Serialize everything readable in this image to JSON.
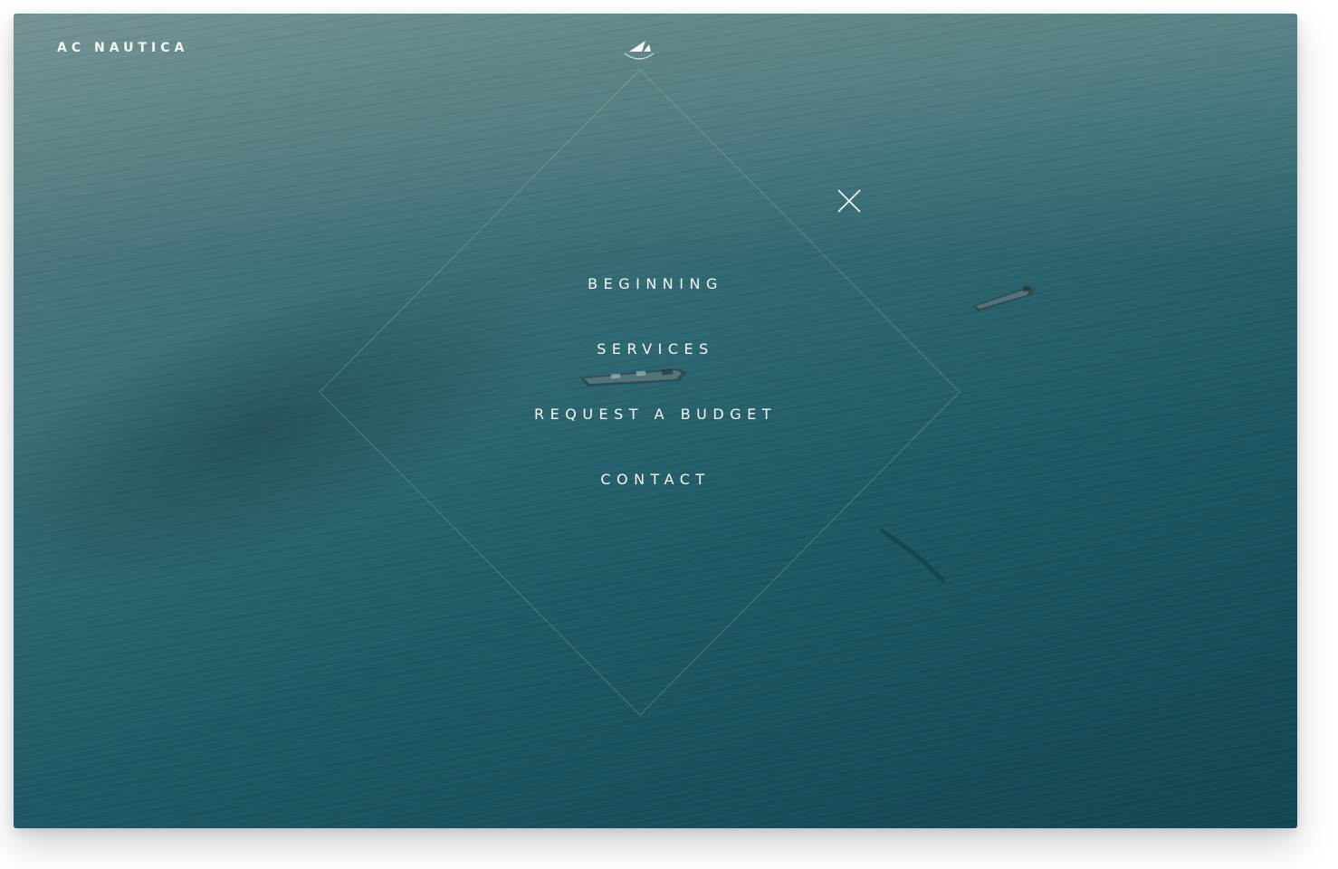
{
  "header": {
    "brand": "AC NAUTICA",
    "logo_icon": "sail-logo-icon"
  },
  "menu": {
    "items": [
      {
        "label": "BEGINNING"
      },
      {
        "label": "SERVICES"
      },
      {
        "label": "REQUEST A BUDGET"
      },
      {
        "label": "CONTACT"
      }
    ],
    "close_icon": "close-icon"
  },
  "colors": {
    "text": "#f4f7f7",
    "sea_dark": "#134654",
    "sea_light": "#6f8f92"
  }
}
